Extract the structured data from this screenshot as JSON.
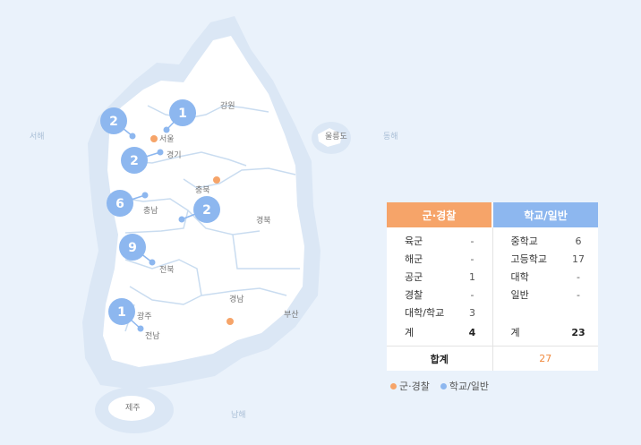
{
  "map": {
    "sea_labels": {
      "west": "서해",
      "east": "동해",
      "south": "남해"
    },
    "region_labels": {
      "seoul": "서울",
      "gangwon": "강원",
      "ulleung": "울릉도",
      "gyeonggi": "경기",
      "chungbuk": "충북",
      "chungnam": "충남",
      "gyeongbuk": "경북",
      "jeonbuk": "전북",
      "gyeongnam": "경남",
      "busan": "부산",
      "gwangju": "광주",
      "jeonnam": "전남",
      "jeju": "제주"
    },
    "markers": [
      {
        "region": "서울",
        "count": "1"
      },
      {
        "region": "서해",
        "count": "2"
      },
      {
        "region": "경기",
        "count": "2"
      },
      {
        "region": "충남",
        "count": "6"
      },
      {
        "region": "충북",
        "count": "2"
      },
      {
        "region": "전북",
        "count": "9"
      },
      {
        "region": "광주",
        "count": "1"
      }
    ],
    "colors": {
      "military_dot": "#f6a469",
      "school_dot": "#8db7ef",
      "marker": "#8db7ef"
    }
  },
  "panel": {
    "military_header": "군·경찰",
    "school_header": "학교/일반",
    "military_rows": [
      {
        "label": "육군",
        "value": "-"
      },
      {
        "label": "해군",
        "value": "-"
      },
      {
        "label": "공군",
        "value": "1"
      },
      {
        "label": "경찰",
        "value": "-"
      },
      {
        "label": "대학/학교",
        "value": "3"
      }
    ],
    "military_total": {
      "label": "계",
      "value": "4"
    },
    "school_rows": [
      {
        "label": "중학교",
        "value": "6"
      },
      {
        "label": "고등학교",
        "value": "17"
      },
      {
        "label": "대학",
        "value": "-"
      },
      {
        "label": "일반",
        "value": "-"
      }
    ],
    "school_total": {
      "label": "계",
      "value": "23"
    },
    "grand_total_label": "합계",
    "grand_total_value": "27"
  },
  "legend": {
    "military": "군·경찰",
    "school": "학교/일반"
  }
}
